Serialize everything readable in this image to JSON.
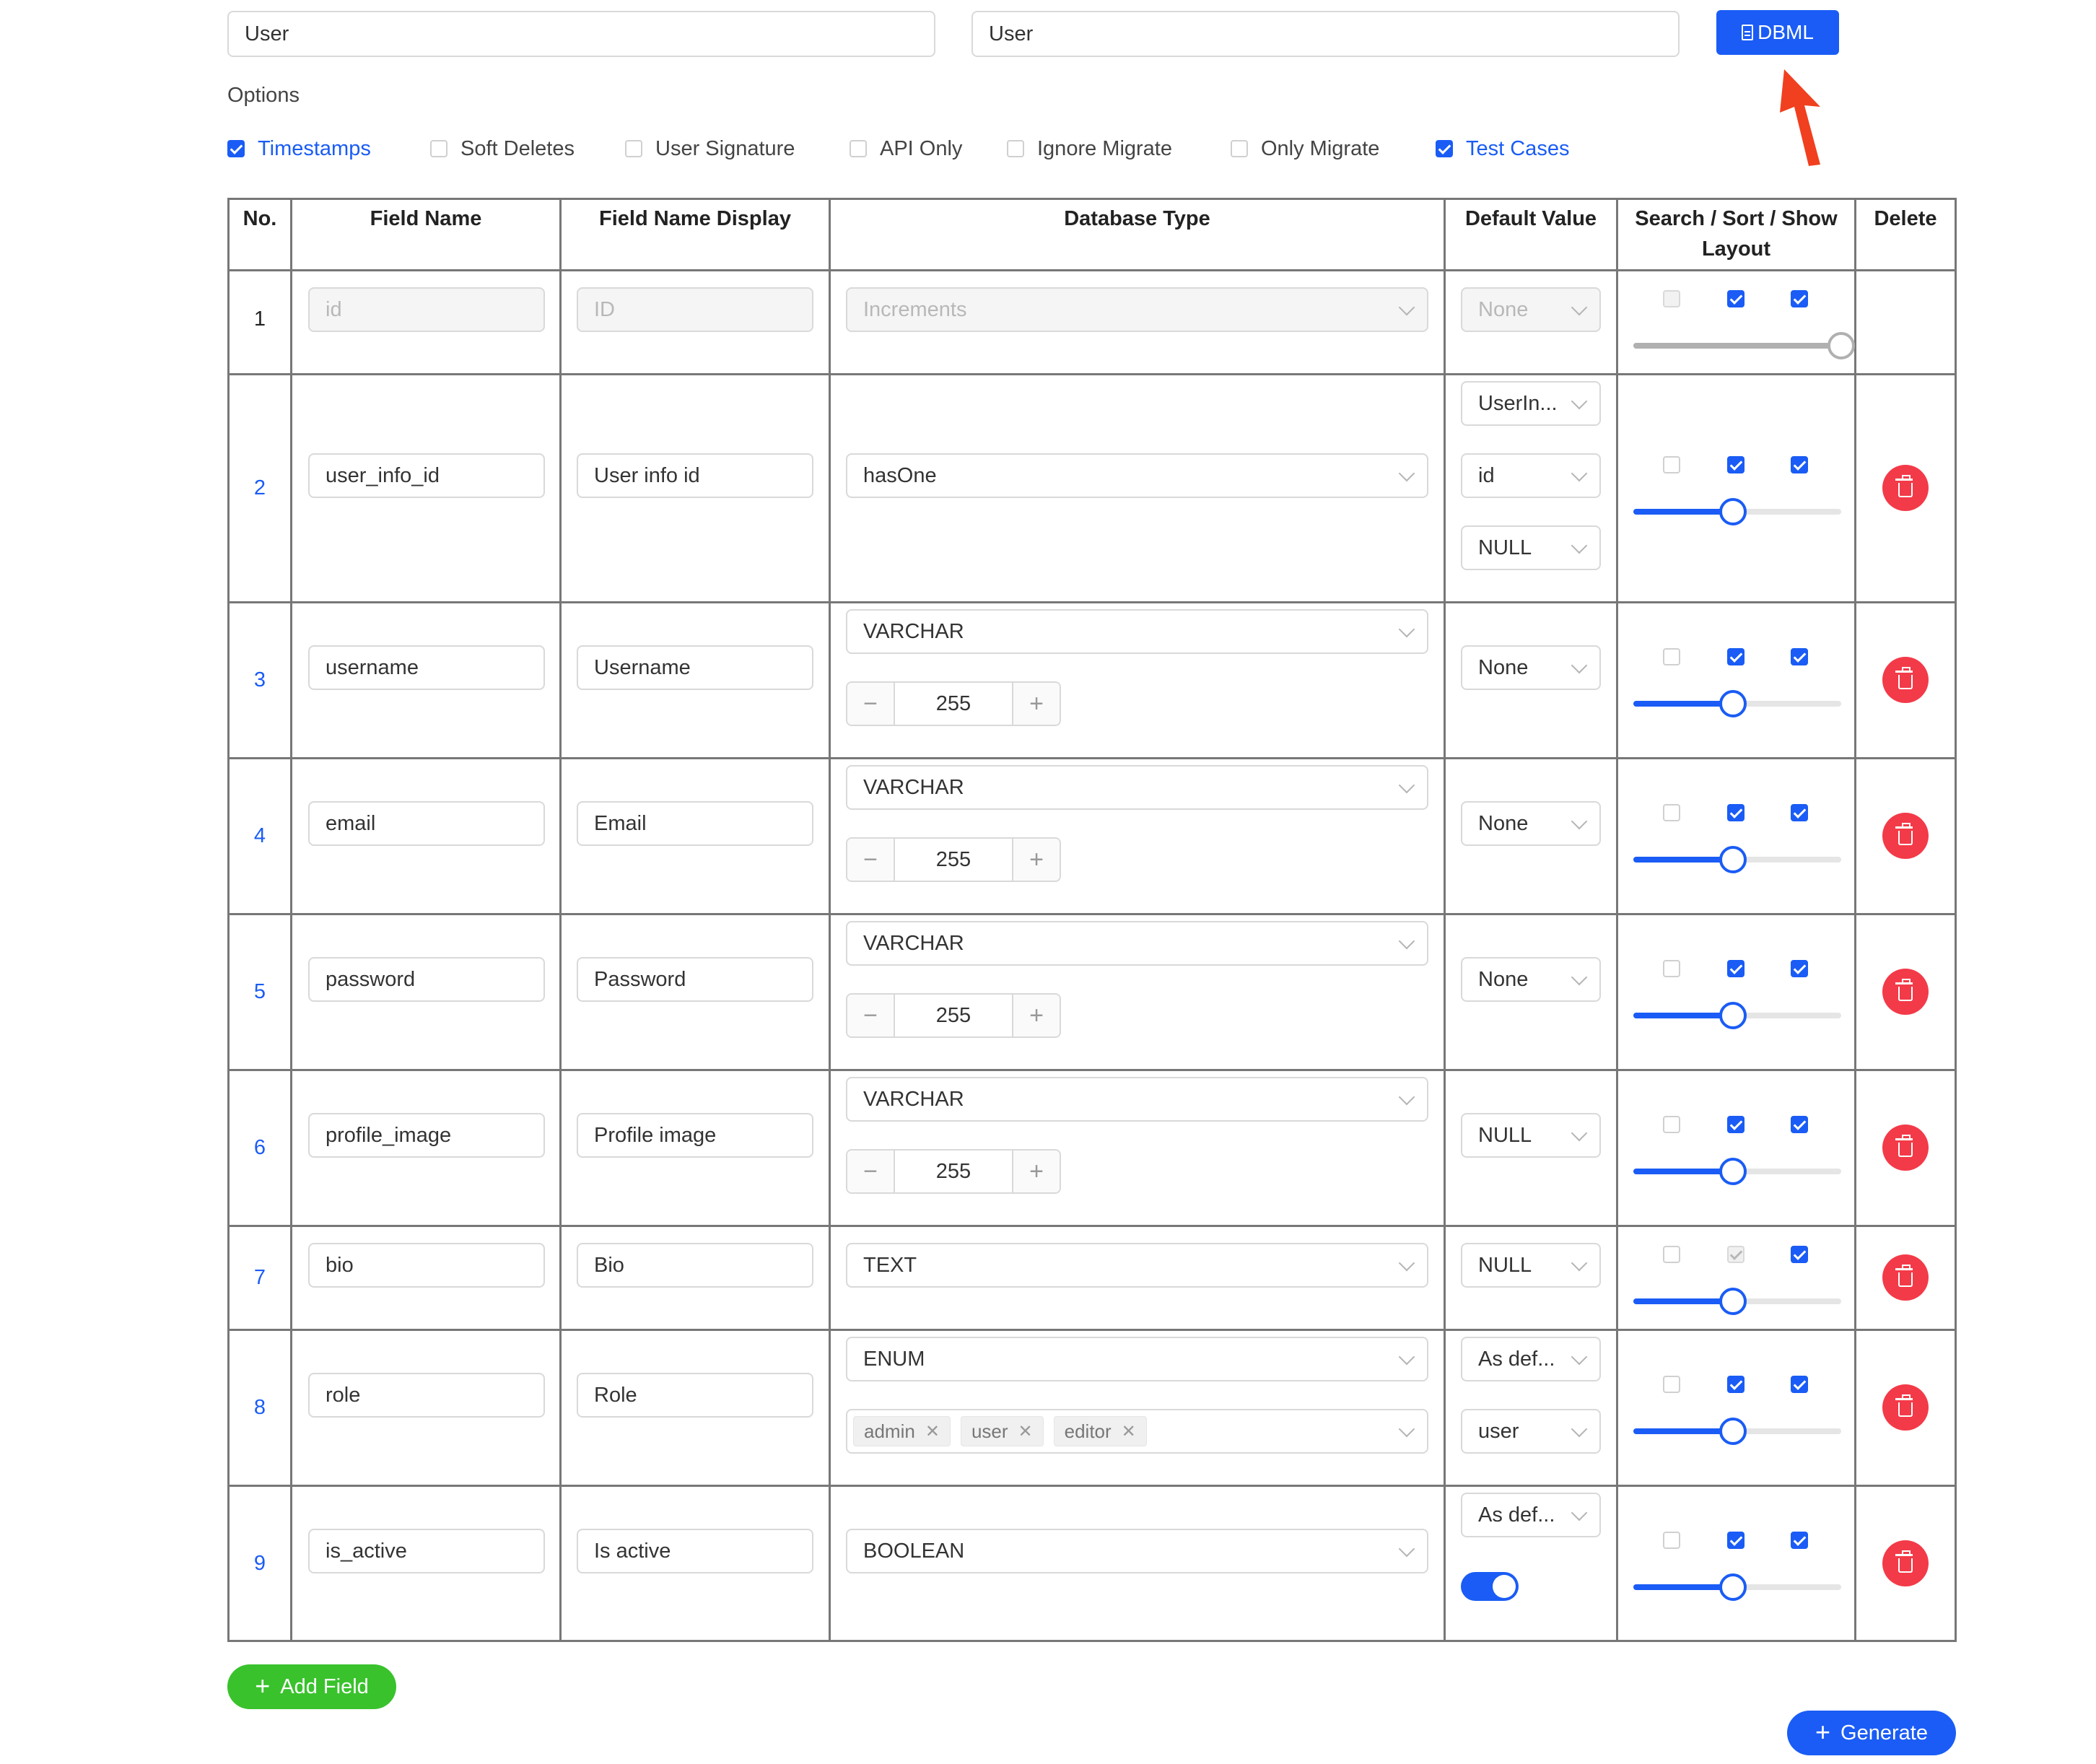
{
  "header": {
    "model_name": "User",
    "table_name": "User",
    "dbml_label": "DBML"
  },
  "options": {
    "label": "Options",
    "items": [
      {
        "label": "Timestamps",
        "checked": true
      },
      {
        "label": "Soft Deletes",
        "checked": false
      },
      {
        "label": "User Signature",
        "checked": false
      },
      {
        "label": "API Only",
        "checked": false
      },
      {
        "label": "Ignore Migrate",
        "checked": false
      },
      {
        "label": "Only Migrate",
        "checked": false
      },
      {
        "label": "Test Cases",
        "checked": true
      }
    ]
  },
  "table": {
    "headers": {
      "no": "No.",
      "field_name": "Field Name",
      "field_display": "Field Name Display",
      "db_type": "Database Type",
      "default": "Default Value",
      "search_sort_show": "Search / Sort / Show",
      "layout": "Layout",
      "delete": "Delete"
    },
    "rows": [
      {
        "no": "1",
        "field": "id",
        "display": "ID",
        "type": "Increments",
        "defaults": [
          "None"
        ],
        "flags": [
          "disabled-off",
          "on",
          "on"
        ],
        "layout": 100
      },
      {
        "no": "2",
        "field": "user_info_id",
        "display": "User info id",
        "type": "hasOne",
        "defaults": [
          "UserIn...",
          "id",
          "NULL"
        ],
        "flags": [
          "off",
          "on",
          "on"
        ],
        "layout": 50
      },
      {
        "no": "3",
        "field": "username",
        "display": "Username",
        "type": "VARCHAR",
        "length": "255",
        "defaults": [
          "None"
        ],
        "flags": [
          "off",
          "on",
          "on"
        ],
        "layout": 50
      },
      {
        "no": "4",
        "field": "email",
        "display": "Email",
        "type": "VARCHAR",
        "length": "255",
        "defaults": [
          "None"
        ],
        "flags": [
          "off",
          "on",
          "on"
        ],
        "layout": 50
      },
      {
        "no": "5",
        "field": "password",
        "display": "Password",
        "type": "VARCHAR",
        "length": "255",
        "defaults": [
          "None"
        ],
        "flags": [
          "off",
          "on",
          "on"
        ],
        "layout": 50
      },
      {
        "no": "6",
        "field": "profile_image",
        "display": "Profile image",
        "type": "VARCHAR",
        "length": "255",
        "defaults": [
          "NULL"
        ],
        "flags": [
          "off",
          "on",
          "on"
        ],
        "layout": 50
      },
      {
        "no": "7",
        "field": "bio",
        "display": "Bio",
        "type": "TEXT",
        "defaults": [
          "NULL"
        ],
        "flags": [
          "off",
          "disabled-on",
          "on"
        ],
        "layout": 50
      },
      {
        "no": "8",
        "field": "role",
        "display": "Role",
        "type": "ENUM",
        "enum_values": [
          "admin",
          "user",
          "editor"
        ],
        "defaults": [
          "As def...",
          "user"
        ],
        "flags": [
          "off",
          "on",
          "on"
        ],
        "layout": 50
      },
      {
        "no": "9",
        "field": "is_active",
        "display": "Is active",
        "type": "BOOLEAN",
        "defaults": [
          "As def..."
        ],
        "default_toggle": true,
        "flags": [
          "off",
          "on",
          "on"
        ],
        "layout": 50
      }
    ]
  },
  "actions": {
    "add_field": "Add Field",
    "generate": "Generate"
  },
  "colors": {
    "primary": "#1a5cf5",
    "success": "#39c22c",
    "danger": "#f33a48",
    "arrow": "#f0401f"
  }
}
